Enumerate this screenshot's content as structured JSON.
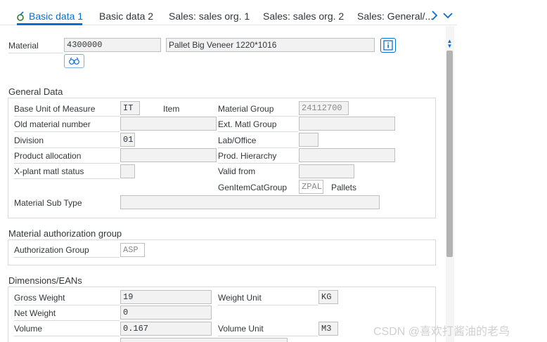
{
  "tabs": [
    {
      "label": "Basic data 1"
    },
    {
      "label": "Basic data 2"
    },
    {
      "label": "Sales: sales org. 1"
    },
    {
      "label": "Sales: sales org. 2"
    },
    {
      "label": "Sales: General/..."
    }
  ],
  "header": {
    "material_label": "Material",
    "material_number": "4300000",
    "material_description": "Pallet Big Veneer 1220*1016"
  },
  "general_data": {
    "title": "General Data",
    "base_uom_label": "Base Unit of Measure",
    "base_uom_value": "IT",
    "base_uom_text": "Item",
    "material_group_label": "Material Group",
    "material_group_value": "24112700",
    "old_material_label": "Old material number",
    "old_material_value": "",
    "ext_matl_group_label": "Ext. Matl Group",
    "ext_matl_group_value": "",
    "division_label": "Division",
    "division_value": "01",
    "lab_office_label": "Lab/Office",
    "lab_office_value": "",
    "product_allocation_label": "Product allocation",
    "product_allocation_value": "",
    "prod_hierarchy_label": "Prod. Hierarchy",
    "prod_hierarchy_value": "",
    "xplant_status_label": "X-plant matl status",
    "xplant_status_value": "",
    "valid_from_label": "Valid from",
    "valid_from_value": "",
    "gen_item_cat_label": "GenItemCatGroup",
    "gen_item_cat_value": "ZPAL",
    "gen_item_cat_text": "Pallets",
    "material_sub_type_label": "Material Sub Type",
    "material_sub_type_value": ""
  },
  "auth_group": {
    "title": "Material authorization group",
    "label": "Authorization Group",
    "value": "ASP"
  },
  "dimensions": {
    "title": "Dimensions/EANs",
    "gross_weight_label": "Gross Weight",
    "gross_weight_value": "19",
    "weight_unit_label": "Weight Unit",
    "weight_unit_value": "KG",
    "net_weight_label": "Net Weight",
    "net_weight_value": "0",
    "volume_label": "Volume",
    "volume_value": "0.167",
    "volume_unit_label": "Volume Unit",
    "volume_unit_value": "M3"
  },
  "watermark": "CSDN @喜欢打酱油的老鸟",
  "colors": {
    "accent": "#0a6ed1",
    "field_bg": "#f2f2f2",
    "border": "#bfbfbf"
  },
  "icons": {
    "tab_icon": "material-icon",
    "info_button": "info-icon",
    "binoculars_button": "binoculars-icon",
    "scroll_right": "chevron-right-icon",
    "overflow": "chevron-down-icon"
  }
}
